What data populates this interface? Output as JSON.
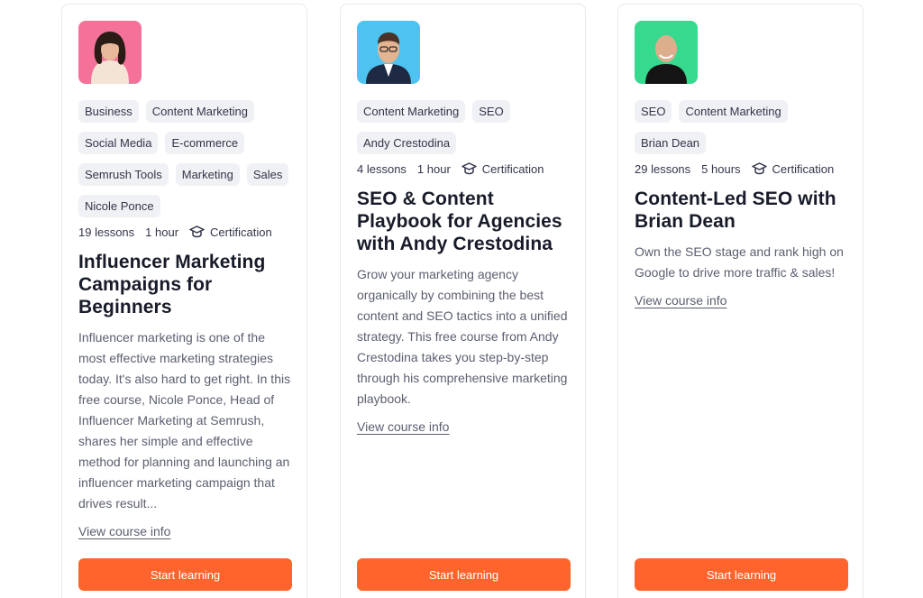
{
  "courses": [
    {
      "tags": [
        "Business",
        "Content Marketing",
        "Social Media",
        "E-commerce",
        "Semrush Tools",
        "Marketing",
        "Sales",
        "Nicole Ponce"
      ],
      "lessons": "19 lessons",
      "duration": "1 hour",
      "certification": "Certification",
      "title": "Influencer Marketing Campaigns for Beginners",
      "description": "Influencer marketing is one of the most effective marketing strategies today. It's also hard to get right. In this free course, Nicole Ponce, Head of Influencer Marketing at Semrush, shares her simple and effective method for planning and launching an influencer marketing campaign that drives result...",
      "view_link": "View course info",
      "cta": "Start learning",
      "avatar_bg": "#f4729a"
    },
    {
      "tags": [
        "Content Marketing",
        "SEO",
        "Andy Crestodina"
      ],
      "lessons": "4 lessons",
      "duration": "1 hour",
      "certification": "Certification",
      "title": "SEO & Content Playbook for Agencies with Andy Crestodina",
      "description": "Grow your marketing agency organically by combining the best content and SEO tactics into a unified strategy. This free course from Andy Crestodina takes you step-by-step through his comprehensive marketing playbook.",
      "view_link": "View course info",
      "cta": "Start learning",
      "avatar_bg": "#4fc3f0"
    },
    {
      "tags": [
        "SEO",
        "Content Marketing",
        "Brian Dean"
      ],
      "lessons": "29 lessons",
      "duration": "5 hours",
      "certification": "Certification",
      "title": "Content-Led SEO with Brian Dean",
      "description": "Own the SEO stage and rank high on Google to drive more traffic & sales!",
      "view_link": "View course info",
      "cta": "Start learning",
      "avatar_bg": "#37d98f"
    }
  ],
  "icons": {
    "certification": "graduation-cap-icon"
  },
  "colors": {
    "accent": "#ff642d",
    "tag_bg": "#f0f1f4",
    "text": "#181b29",
    "muted": "#5b5f70"
  }
}
